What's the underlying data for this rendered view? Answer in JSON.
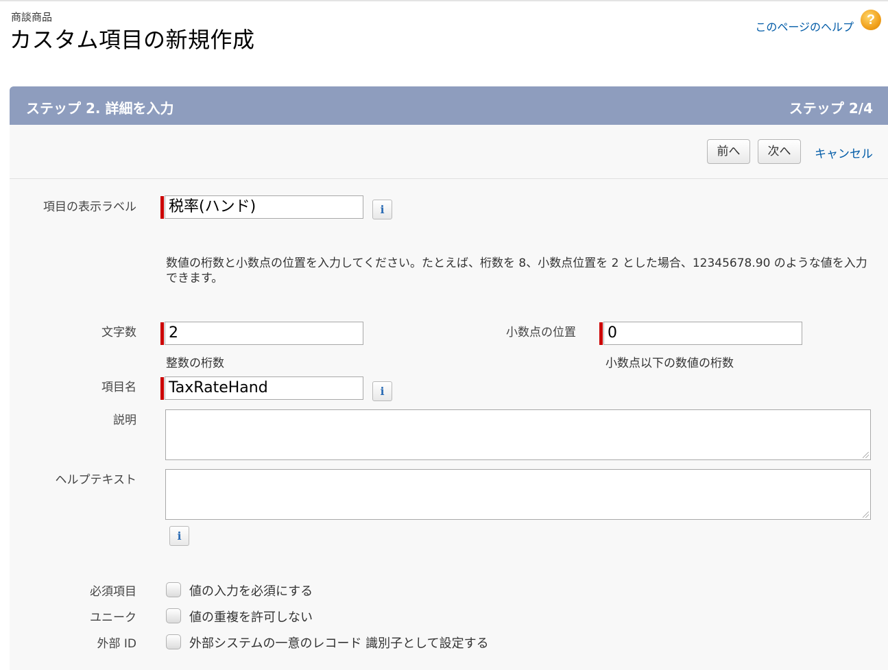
{
  "header": {
    "breadcrumb": "商談商品",
    "title": "カスタム項目の新規作成",
    "help_link": "このページのヘルプ",
    "help_icon": "question-icon"
  },
  "step": {
    "title": "ステップ 2. 詳細を入力",
    "count": "ステップ 2/4"
  },
  "buttons": {
    "prev": "前へ",
    "next": "次へ",
    "cancel": "キャンセル"
  },
  "fields": {
    "label": {
      "label": "項目の表示ラベル",
      "value": "税率(ハンド)"
    },
    "description_text": "数値の桁数と小数点の位置を入力してください。たとえば、桁数を 8、小数点位置を 2 とした場合、12345678.90 のような値を入力できます。",
    "length": {
      "label": "文字数",
      "value": "2",
      "hint": "整数の桁数"
    },
    "decimal": {
      "label": "小数点の位置",
      "value": "0",
      "hint": "小数点以下の数値の桁数"
    },
    "api_name": {
      "label": "項目名",
      "value": "TaxRateHand"
    },
    "description": {
      "label": "説明",
      "value": ""
    },
    "help_text": {
      "label": "ヘルプテキスト",
      "value": ""
    },
    "info_icon": "i"
  },
  "options": {
    "required": {
      "label": "必須項目",
      "text": "値の入力を必須にする",
      "checked": false
    },
    "unique": {
      "label": "ユニーク",
      "text": "値の重複を許可しない",
      "checked": false
    },
    "external_id": {
      "label": "外部 ID",
      "text": "外部システムの一意のレコード 識別子として設定する",
      "checked": false
    }
  },
  "colors": {
    "header_bar": "#8e9dbe",
    "link": "#015ba7",
    "required": "#cc0000"
  }
}
